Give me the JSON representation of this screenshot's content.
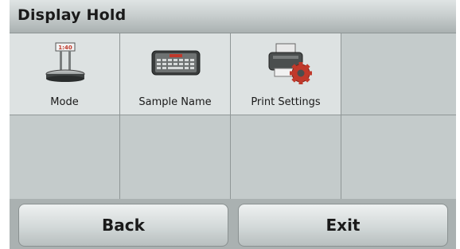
{
  "header": {
    "title": "Display Hold"
  },
  "menu": {
    "items": [
      {
        "label": "Mode",
        "icon": "scale-icon"
      },
      {
        "label": "Sample Name",
        "icon": "keyboard-icon"
      },
      {
        "label": "Print Settings",
        "icon": "printer-settings-icon"
      }
    ]
  },
  "scale_display": "1:40",
  "footer": {
    "back_label": "Back",
    "exit_label": "Exit"
  },
  "colors": {
    "background": "#b9c0c0",
    "accent": "#c0392b"
  }
}
